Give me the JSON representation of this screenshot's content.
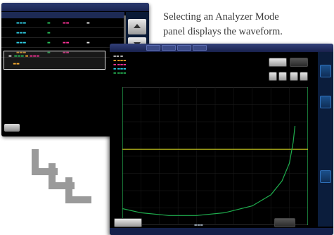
{
  "caption": {
    "line1": "Selecting an Analyzer Mode",
    "line2": "panel displays the waveform."
  },
  "colors": {
    "screen_bg": "#000000",
    "titlebar": "#2b3a6e",
    "trace_green": "#1fae4e",
    "trace_yellow": "#c8c81e",
    "trace_cyan": "#2fd0e8",
    "trace_magenta": "#ff3399",
    "accent_blue": "#1b4f8a"
  },
  "icons": {
    "chevron": "double-chevron-down-right-icon",
    "arrow_up": "triangle-up-icon",
    "arrow_down": "triangle-down-icon"
  },
  "plot": {
    "type": "line",
    "series": [
      {
        "color": "green",
        "points": [
          [
            0,
            0.88
          ],
          [
            0.1,
            0.91
          ],
          [
            0.25,
            0.93
          ],
          [
            0.4,
            0.93
          ],
          [
            0.55,
            0.91
          ],
          [
            0.7,
            0.86
          ],
          [
            0.8,
            0.78
          ],
          [
            0.86,
            0.68
          ],
          [
            0.9,
            0.55
          ],
          [
            0.92,
            0.4
          ],
          [
            0.93,
            0.28
          ]
        ]
      },
      {
        "color": "yellow",
        "points": [
          [
            0,
            0.45
          ],
          [
            1,
            0.45
          ]
        ]
      }
    ]
  }
}
